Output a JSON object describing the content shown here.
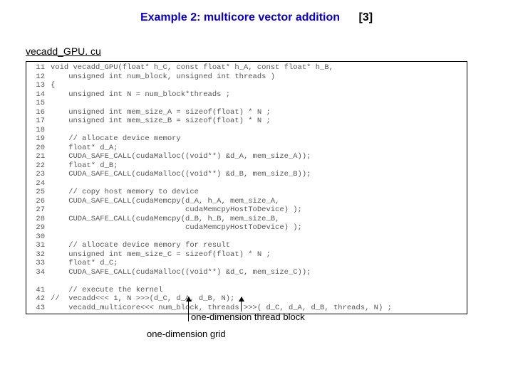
{
  "title": {
    "main": "Example 2: multicore vector addition",
    "ref": "[3]"
  },
  "filename": "vecadd_GPU. cu",
  "code_lines": [
    {
      "n": "11",
      "t": "void vecadd_GPU(float* h_C, const float* h_A, const float* h_B,"
    },
    {
      "n": "12",
      "t": "    unsigned int num_block, unsigned int threads )"
    },
    {
      "n": "13",
      "t": "{"
    },
    {
      "n": "14",
      "t": "    unsigned int N = num_block*threads ;"
    },
    {
      "n": "15",
      "t": ""
    },
    {
      "n": "16",
      "t": "    unsigned int mem_size_A = sizeof(float) * N ;"
    },
    {
      "n": "17",
      "t": "    unsigned int mem_size_B = sizeof(float) * N ;"
    },
    {
      "n": "18",
      "t": ""
    },
    {
      "n": "19",
      "t": "    // allocate device memory"
    },
    {
      "n": "20",
      "t": "    float* d_A;"
    },
    {
      "n": "21",
      "t": "    CUDA_SAFE_CALL(cudaMalloc((void**) &d_A, mem_size_A));"
    },
    {
      "n": "22",
      "t": "    float* d_B;"
    },
    {
      "n": "23",
      "t": "    CUDA_SAFE_CALL(cudaMalloc((void**) &d_B, mem_size_B));"
    },
    {
      "n": "24",
      "t": ""
    },
    {
      "n": "25",
      "t": "    // copy host memory to device"
    },
    {
      "n": "26",
      "t": "    CUDA_SAFE_CALL(cudaMemcpy(d_A, h_A, mem_size_A,"
    },
    {
      "n": "27",
      "t": "                              cudaMemcpyHostToDevice) );"
    },
    {
      "n": "28",
      "t": "    CUDA_SAFE_CALL(cudaMemcpy(d_B, h_B, mem_size_B,"
    },
    {
      "n": "29",
      "t": "                              cudaMemcpyHostToDevice) );"
    },
    {
      "n": "30",
      "t": ""
    },
    {
      "n": "31",
      "t": "    // allocate device memory for result"
    },
    {
      "n": "32",
      "t": "    unsigned int mem_size_C = sizeof(float) * N ;"
    },
    {
      "n": "33",
      "t": "    float* d_C;"
    },
    {
      "n": "34",
      "t": "    CUDA_SAFE_CALL(cudaMalloc((void**) &d_C, mem_size_C));"
    },
    {
      "n": "",
      "t": ""
    },
    {
      "n": "41",
      "t": "    // execute the kernel"
    },
    {
      "n": "42",
      "t": "//  vecadd<<< 1, N >>>(d_C, d_A, d_B, N);"
    },
    {
      "n": "43",
      "t": "    vecadd_multicore<<< num_block, threads >>>( d_C, d_A, d_B, threads, N) ;"
    }
  ],
  "annotations": {
    "thread_block": "one-dimension thread block",
    "grid": "one-dimension grid"
  }
}
